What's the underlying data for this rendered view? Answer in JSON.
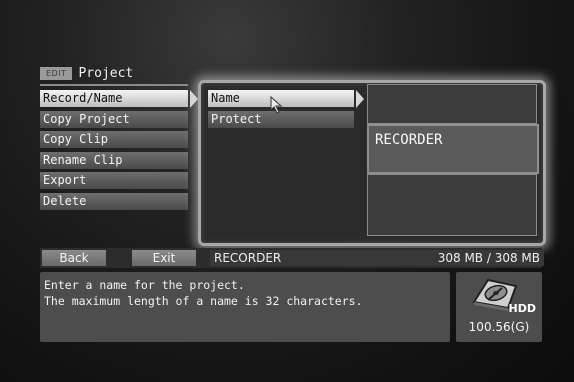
{
  "header": {
    "tag": "EDIT",
    "title": "Project"
  },
  "left_menu": [
    {
      "label": "Record/Name",
      "selected": true
    },
    {
      "label": "Copy Project",
      "selected": false
    },
    {
      "label": "Copy Clip",
      "selected": false
    },
    {
      "label": "Rename Clip",
      "selected": false
    },
    {
      "label": "Export",
      "selected": false
    },
    {
      "label": "Delete",
      "selected": false
    }
  ],
  "submenu": [
    {
      "label": "Name",
      "selected": true
    },
    {
      "label": "Protect",
      "selected": false
    }
  ],
  "name_display": "RECORDER",
  "bottom_bar": {
    "back_label": "Back",
    "exit_label": "Exit",
    "recorder_name": "RECORDER",
    "capacity": "308 MB / 308 MB"
  },
  "message": {
    "line1": "Enter a name for the project.",
    "line2": "The maximum length of a name is 32 characters."
  },
  "hdd": {
    "label": "HDD",
    "size": "100.56(G)",
    "icon": "hdd-icon"
  },
  "colors": {
    "highlight": "#f4f4f4",
    "panel_border": "#a8a8a8",
    "background": "#141414"
  }
}
